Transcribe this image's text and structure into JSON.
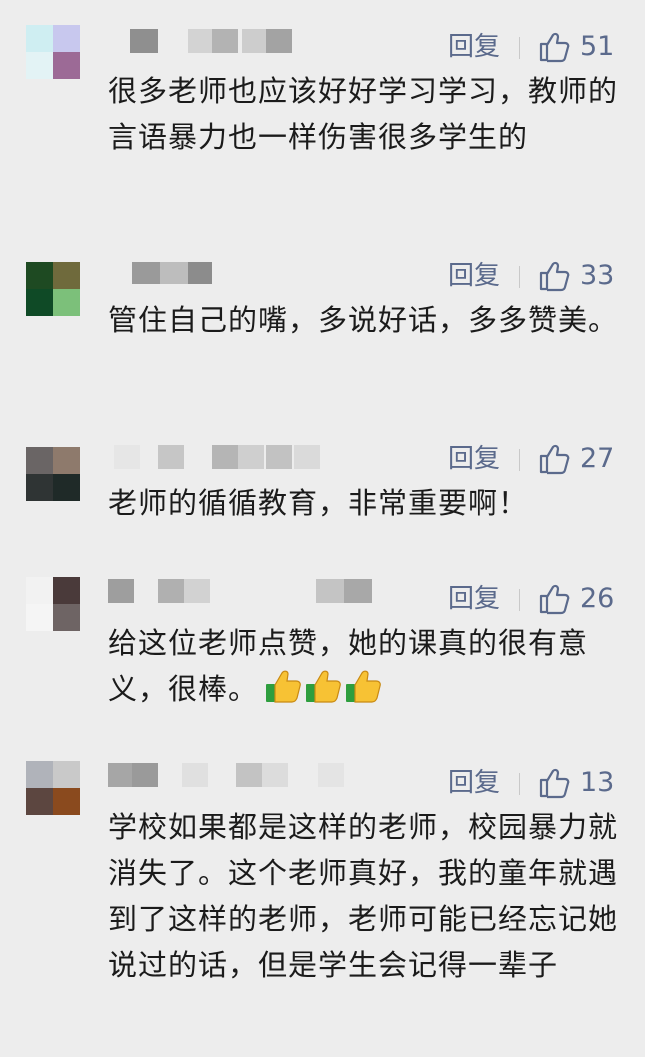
{
  "reply_label": "回复",
  "comments": [
    {
      "likes": "51",
      "text": "很多老师也应该好好学习学习，教师的言语暴力也一样伤害很多学生的",
      "avatar_colors": [
        "#cfeef2",
        "#c8c8ee",
        "#e3f3f5",
        "#9c6a96"
      ]
    },
    {
      "likes": "33",
      "text": "管住自己的嘴，多说好话，多多赞美。",
      "avatar_colors": [
        "#1e4a22",
        "#6f6a3c",
        "#0f4a26",
        "#7cc07a"
      ]
    },
    {
      "likes": "27",
      "text": "老师的循循教育，非常重要啊！",
      "avatar_colors": [
        "#6a6565",
        "#8e7a6c",
        "#2f3434",
        "#1f2a28"
      ]
    },
    {
      "likes": "26",
      "text": "给这位老师点赞，她的课真的很有意义，很棒。",
      "emojis": [
        "thumbs-up-icon",
        "thumbs-up-icon",
        "thumbs-up-icon"
      ],
      "avatar_colors": [
        "#f2f2f2",
        "#4a3a3a",
        "#f5f5f5",
        "#6e6464"
      ]
    },
    {
      "likes": "13",
      "text": "学校如果都是这样的老师，校园暴力就消失了。这个老师真好，我的童年就遇到了这样的老师，老师可能已经忘记她说过的话，但是学生会记得一辈子",
      "avatar_colors": [
        "#b0b3ba",
        "#c9c9c9",
        "#5c4640",
        "#8a4a1e"
      ]
    }
  ]
}
